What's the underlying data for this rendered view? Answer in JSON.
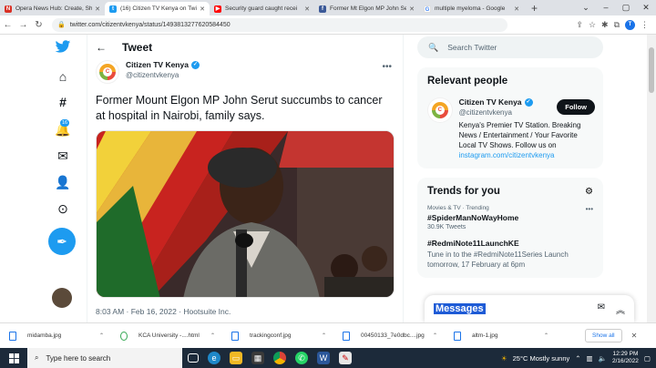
{
  "browser": {
    "tabs": [
      {
        "title": "Opera News Hub: Create, Sh",
        "icon": "opera-news-icon",
        "color": "#d93025"
      },
      {
        "title": "(16) Citizen TV Kenya on Twi",
        "icon": "twitter-icon",
        "color": "#1d9bf0",
        "active": true
      },
      {
        "title": "Security guard caught recei",
        "icon": "youtube-icon",
        "color": "#ff0000"
      },
      {
        "title": "Former Mt Elgon MP John Se",
        "icon": "tab-site-icon",
        "color": "#3b5998"
      },
      {
        "title": "multiple myeloma - Google",
        "icon": "google-icon",
        "color": "#4285f4"
      }
    ],
    "new_tab": "+",
    "url": "twitter.com/citizentvkenya/status/1493813277620584450",
    "profile_initial": "T"
  },
  "nav": {
    "notifications_count": "16",
    "compose_icon": "feather-icon"
  },
  "tweet": {
    "header": "Tweet",
    "author_name": "Citizen TV Kenya",
    "author_handle": "@citizentvkenya",
    "logo_letter": "C",
    "text": "Former Mount Elgon MP John Serut succumbs to cancer at hospital in Nairobi, family says.",
    "meta": "8:03 AM · Feb 16, 2022 · Hootsuite Inc."
  },
  "sidebar": {
    "search_placeholder": "Search Twitter",
    "relevant_title": "Relevant people",
    "person_name": "Citizen TV Kenya",
    "person_handle": "@citizentvkenya",
    "follow_label": "Follow",
    "bio": "Kenya's Premier TV Station. Breaking News / Entertainment / Your Favorite Local TV Shows. Follow us on",
    "bio_link": "instagram.com/citizentvkenya",
    "trends_title": "Trends for you",
    "trends": [
      {
        "category": "Movies & TV · Trending",
        "name": "#SpiderManNoWayHome",
        "count": "30.9K Tweets"
      },
      {
        "category": "",
        "name": "#RedmiNote11LaunchKE",
        "desc": "Tune in to the #RedmiNote11Series Launch tomorrow, 17 February at 6pm"
      }
    ],
    "messages_label": "Messages"
  },
  "downloads": {
    "items": [
      "midamba.jpg",
      "KCA University -....html",
      "trackingconf.jpg",
      "00450133_7e0dbc....jpg",
      "altm-1.jpg"
    ],
    "show_all": "Show all"
  },
  "taskbar": {
    "search_placeholder": "Type here to search",
    "weather": "25°C  Mostly sunny",
    "time": "12:29 PM",
    "date": "2/16/2022"
  },
  "colors": {
    "twitter_blue": "#1d9bf0",
    "text_dark": "#0f1419",
    "text_muted": "#536471"
  }
}
